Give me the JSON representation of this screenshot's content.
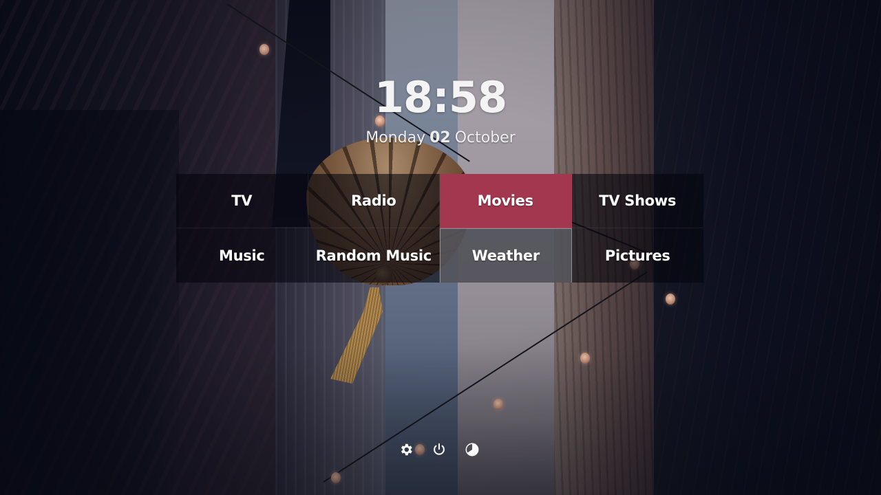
{
  "clock": {
    "time": "18:58",
    "weekday": "Monday",
    "day": "02",
    "month": "October"
  },
  "menu": {
    "selected": "Movies",
    "accent_color": "#A3374F",
    "items": [
      {
        "label": "TV",
        "icon": "tv-icon"
      },
      {
        "label": "Radio",
        "icon": "radio-icon"
      },
      {
        "label": "Movies",
        "icon": "movies-icon"
      },
      {
        "label": "TV Shows",
        "icon": "tv-shows-icon"
      },
      {
        "label": "Music",
        "icon": "music-icon"
      },
      {
        "label": "Random Music",
        "icon": "random-music-icon"
      },
      {
        "label": "Weather",
        "icon": "weather-icon"
      },
      {
        "label": "Pictures",
        "icon": "pictures-icon"
      }
    ]
  },
  "bottom_bar": {
    "buttons": [
      {
        "name": "settings",
        "icon": "gear-icon"
      },
      {
        "name": "power",
        "icon": "power-icon"
      },
      {
        "name": "theme",
        "icon": "contrast-icon"
      }
    ]
  }
}
